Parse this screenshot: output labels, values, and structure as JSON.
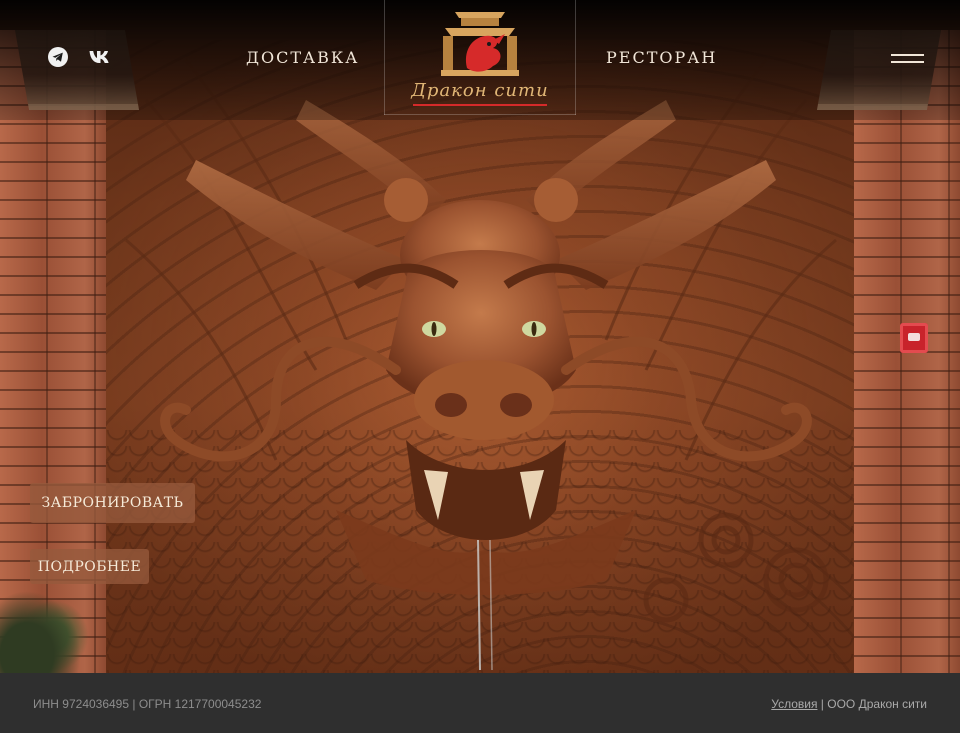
{
  "header": {
    "nav_delivery": "Доставка",
    "nav_restaurant": "Ресторан",
    "logo_text": "Дракон сити",
    "social": [
      "telegram-icon",
      "vk-icon"
    ]
  },
  "hero": {
    "book_button": "Забронировать",
    "more_button": "Подробнее"
  },
  "footer": {
    "legal": "ИНН 9724036495 | ОГРН 1217700045232",
    "terms_link": "Условия",
    "separator": " | ",
    "company": "ООО Дракон сити"
  },
  "colors": {
    "accent_red": "#d42a2a",
    "logo_gold": "#e0b676",
    "button_bg": "#965a3c",
    "footer_bg": "#2f2f2f"
  }
}
